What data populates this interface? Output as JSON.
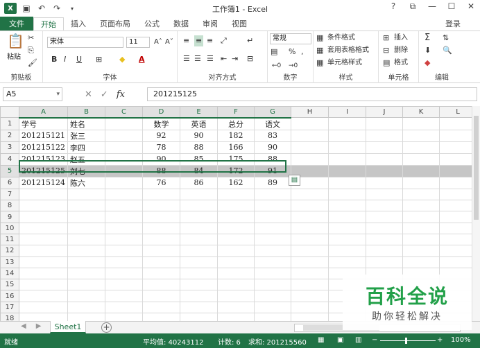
{
  "window": {
    "title": "工作簿1 - Excel",
    "app_icon_letter": "X",
    "help": "?",
    "controls": [
      "⧉",
      "—",
      "☐",
      "✕"
    ]
  },
  "ribbon_tabs": {
    "file": "文件",
    "tabs": [
      "开始",
      "插入",
      "页面布局",
      "公式",
      "数据",
      "审阅",
      "视图"
    ],
    "active": "开始",
    "login": "登录"
  },
  "ribbon": {
    "clipboard": {
      "label": "剪贴板",
      "paste": "粘贴"
    },
    "font": {
      "label": "字体",
      "font_name": "宋体",
      "font_size": "11",
      "grow": "A˄",
      "shrink": "A˅",
      "bold": "B",
      "italic": "I",
      "underline": "U",
      "font_color_letter": "A"
    },
    "alignment": {
      "label": "对齐方式"
    },
    "number": {
      "label": "数字",
      "format": "常规",
      "percent": "%",
      "comma": ","
    },
    "styles": {
      "label": "样式",
      "conditional": "条件格式",
      "table_format": "套用表格格式",
      "cell_styles": "单元格样式"
    },
    "cells": {
      "label": "单元格",
      "insert": "插入",
      "delete": "删除",
      "format": "格式"
    },
    "editing": {
      "label": "编辑"
    }
  },
  "formula_bar": {
    "name_box": "A5",
    "fx": "fx",
    "value": "201215125"
  },
  "columns": [
    "A",
    "B",
    "C",
    "D",
    "E",
    "F",
    "G",
    "H",
    "I",
    "J",
    "K",
    "L"
  ],
  "rows": [
    [
      "学号",
      "姓名",
      "",
      "数学",
      "英语",
      "总分",
      "语文",
      "",
      "",
      "",
      "",
      ""
    ],
    [
      "201215121",
      "张三",
      "",
      "92",
      "90",
      "182",
      "83",
      "",
      "",
      "",
      "",
      ""
    ],
    [
      "201215122",
      "李四",
      "",
      "78",
      "88",
      "166",
      "90",
      "",
      "",
      "",
      "",
      ""
    ],
    [
      "201215123",
      "赵五",
      "",
      "90",
      "85",
      "175",
      "88",
      "",
      "",
      "",
      "",
      ""
    ],
    [
      "201215125",
      "刘七",
      "",
      "88",
      "84",
      "172",
      "91",
      "",
      "",
      "",
      "",
      ""
    ],
    [
      "201215124",
      "陈六",
      "",
      "76",
      "86",
      "162",
      "89",
      "",
      "",
      "",
      "",
      ""
    ],
    [
      "",
      "",
      "",
      "",
      "",
      "",
      "",
      "",
      "",
      "",
      "",
      ""
    ],
    [
      "",
      "",
      "",
      "",
      "",
      "",
      "",
      "",
      "",
      "",
      "",
      ""
    ],
    [
      "",
      "",
      "",
      "",
      "",
      "",
      "",
      "",
      "",
      "",
      "",
      ""
    ],
    [
      "",
      "",
      "",
      "",
      "",
      "",
      "",
      "",
      "",
      "",
      "",
      ""
    ],
    [
      "",
      "",
      "",
      "",
      "",
      "",
      "",
      "",
      "",
      "",
      "",
      ""
    ],
    [
      "",
      "",
      "",
      "",
      "",
      "",
      "",
      "",
      "",
      "",
      "",
      ""
    ],
    [
      "",
      "",
      "",
      "",
      "",
      "",
      "",
      "",
      "",
      "",
      "",
      ""
    ],
    [
      "",
      "",
      "",
      "",
      "",
      "",
      "",
      "",
      "",
      "",
      "",
      ""
    ],
    [
      "",
      "",
      "",
      "",
      "",
      "",
      "",
      "",
      "",
      "",
      "",
      ""
    ],
    [
      "",
      "",
      "",
      "",
      "",
      "",
      "",
      "",
      "",
      "",
      "",
      ""
    ],
    [
      "",
      "",
      "",
      "",
      "",
      "",
      "",
      "",
      "",
      "",
      "",
      ""
    ],
    [
      "",
      "",
      "",
      "",
      "",
      "",
      "",
      "",
      "",
      "",
      "",
      ""
    ]
  ],
  "selection": {
    "row": 5,
    "columns": [
      "A",
      "B",
      "C",
      "D",
      "E",
      "F",
      "G"
    ]
  },
  "sheet_tabs": {
    "tabs": [
      "Sheet1"
    ],
    "add": "+"
  },
  "status": {
    "ready": "就绪",
    "average": "平均值: 40243112",
    "count": "计数: 6",
    "sum": "求和: 201215560",
    "zoom": "100%"
  },
  "watermark": {
    "main": "百科全说",
    "sub": "助你轻松解决"
  },
  "colors": {
    "accent": "#217346",
    "selection_fill": "#c6c6c6",
    "watermark_green": "#22a049"
  }
}
